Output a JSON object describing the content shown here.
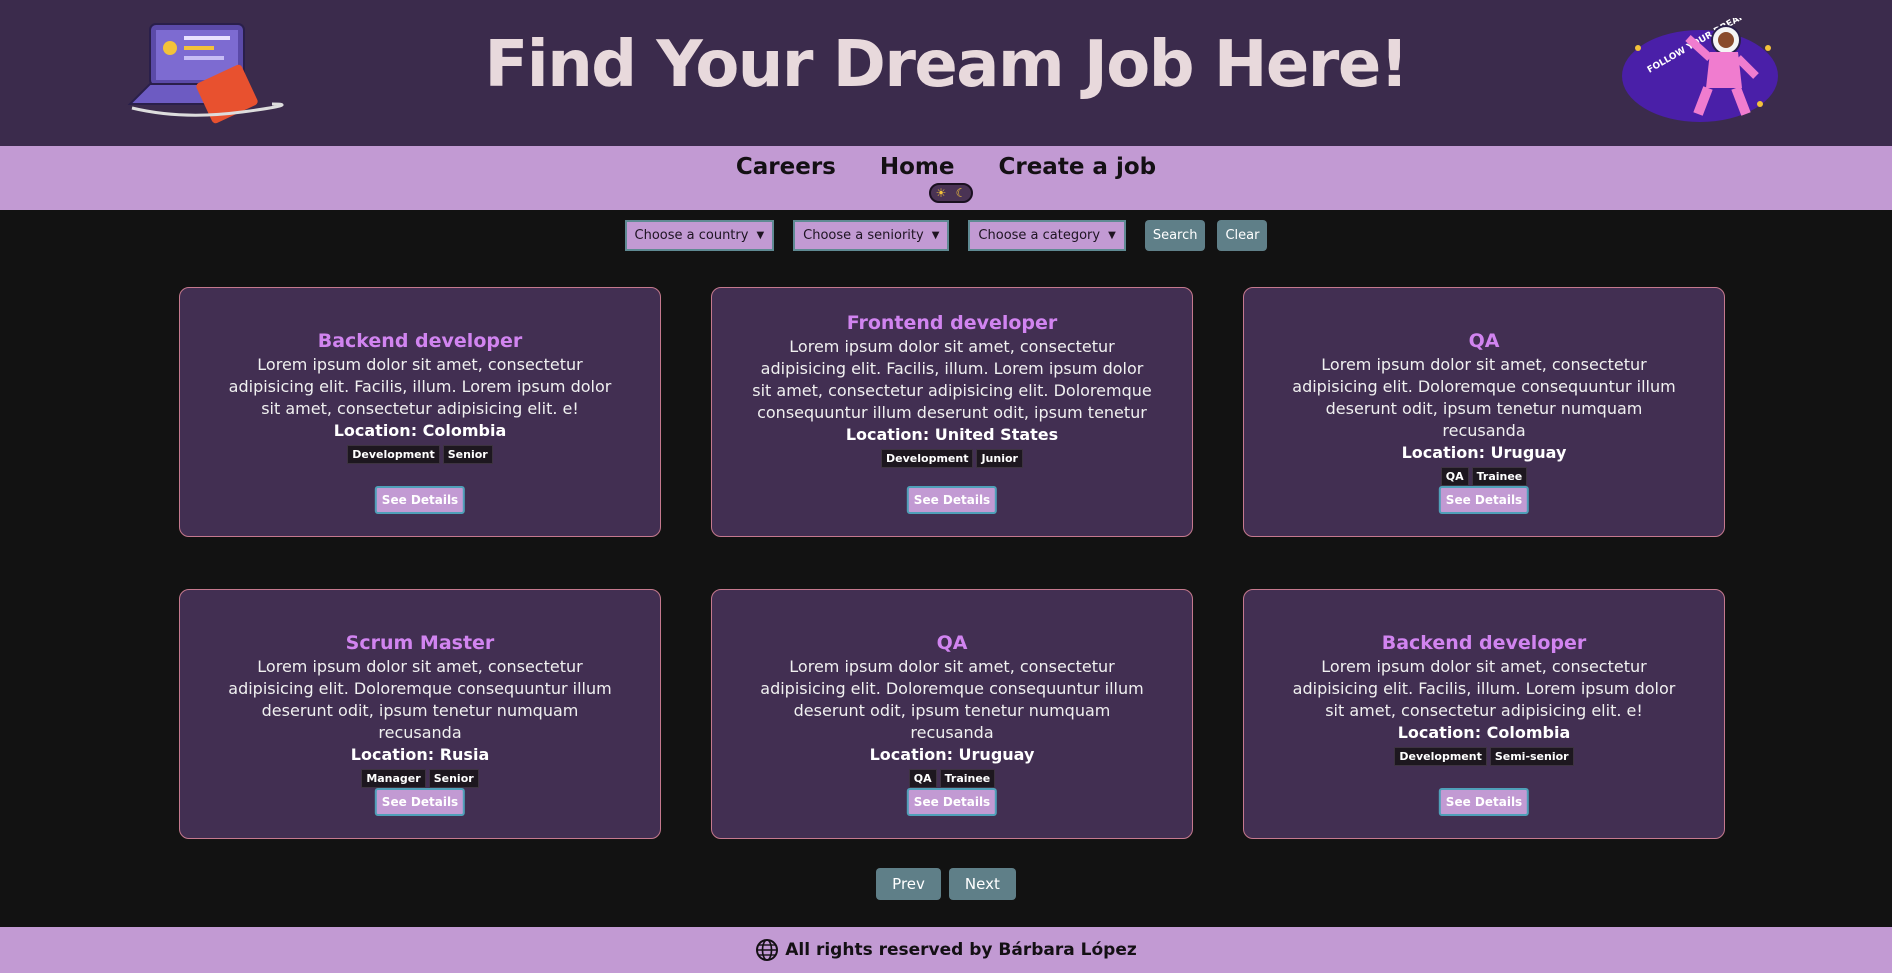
{
  "header": {
    "title": "Find Your Dream Job Here!",
    "sticker_text": "FOLLOW YOUR DREAM!"
  },
  "nav": {
    "items": [
      {
        "label": "Careers"
      },
      {
        "label": "Home"
      },
      {
        "label": "Create a job"
      }
    ]
  },
  "filters": {
    "country": "Choose a country",
    "seniority": "Choose a seniority",
    "category": "Choose a category",
    "search": "Search",
    "clear": "Clear"
  },
  "jobs": [
    {
      "title": "Backend developer",
      "desc": "Lorem ipsum dolor sit amet, consectetur adipisicing elit. Facilis, illum. Lorem ipsum dolor sit amet, consectetur adipisicing elit. e!",
      "location": "Location: Colombia",
      "tags": [
        "Development",
        "Senior"
      ],
      "button": "See Details"
    },
    {
      "title": "Frontend developer",
      "desc": "Lorem ipsum dolor sit amet, consectetur adipisicing elit. Facilis, illum. Lorem ipsum dolor sit amet, consectetur adipisicing elit. Doloremque consequuntur illum deserunt odit, ipsum tenetur numquam recusandae",
      "location": "Location: United States",
      "tags": [
        "Development",
        "Junior"
      ],
      "button": "See Details"
    },
    {
      "title": "QA",
      "desc": "Lorem ipsum dolor sit amet, consectetur adipisicing elit. Doloremque consequuntur illum deserunt odit, ipsum tenetur numquam recusanda",
      "location": "Location: Uruguay",
      "tags": [
        "QA",
        "Trainee"
      ],
      "button": "See Details"
    },
    {
      "title": "Scrum Master",
      "desc": "Lorem ipsum dolor sit amet, consectetur adipisicing elit. Doloremque consequuntur illum deserunt odit, ipsum tenetur numquam recusanda",
      "location": "Location: Rusia",
      "tags": [
        "Manager",
        "Senior"
      ],
      "button": "See Details"
    },
    {
      "title": "QA",
      "desc": "Lorem ipsum dolor sit amet, consectetur adipisicing elit. Doloremque consequuntur illum deserunt odit, ipsum tenetur numquam recusanda",
      "location": "Location: Uruguay",
      "tags": [
        "QA",
        "Trainee"
      ],
      "button": "See Details"
    },
    {
      "title": "Backend developer",
      "desc": "Lorem ipsum dolor sit amet, consectetur adipisicing elit. Facilis, illum. Lorem ipsum dolor sit amet, consectetur adipisicing elit. e!",
      "location": "Location: Colombia",
      "tags": [
        "Development",
        "Semi-senior"
      ],
      "button": "See Details"
    }
  ],
  "pagination": {
    "prev": "Prev",
    "next": "Next"
  },
  "footer": {
    "text": "All rights reserved by Bárbara López"
  }
}
